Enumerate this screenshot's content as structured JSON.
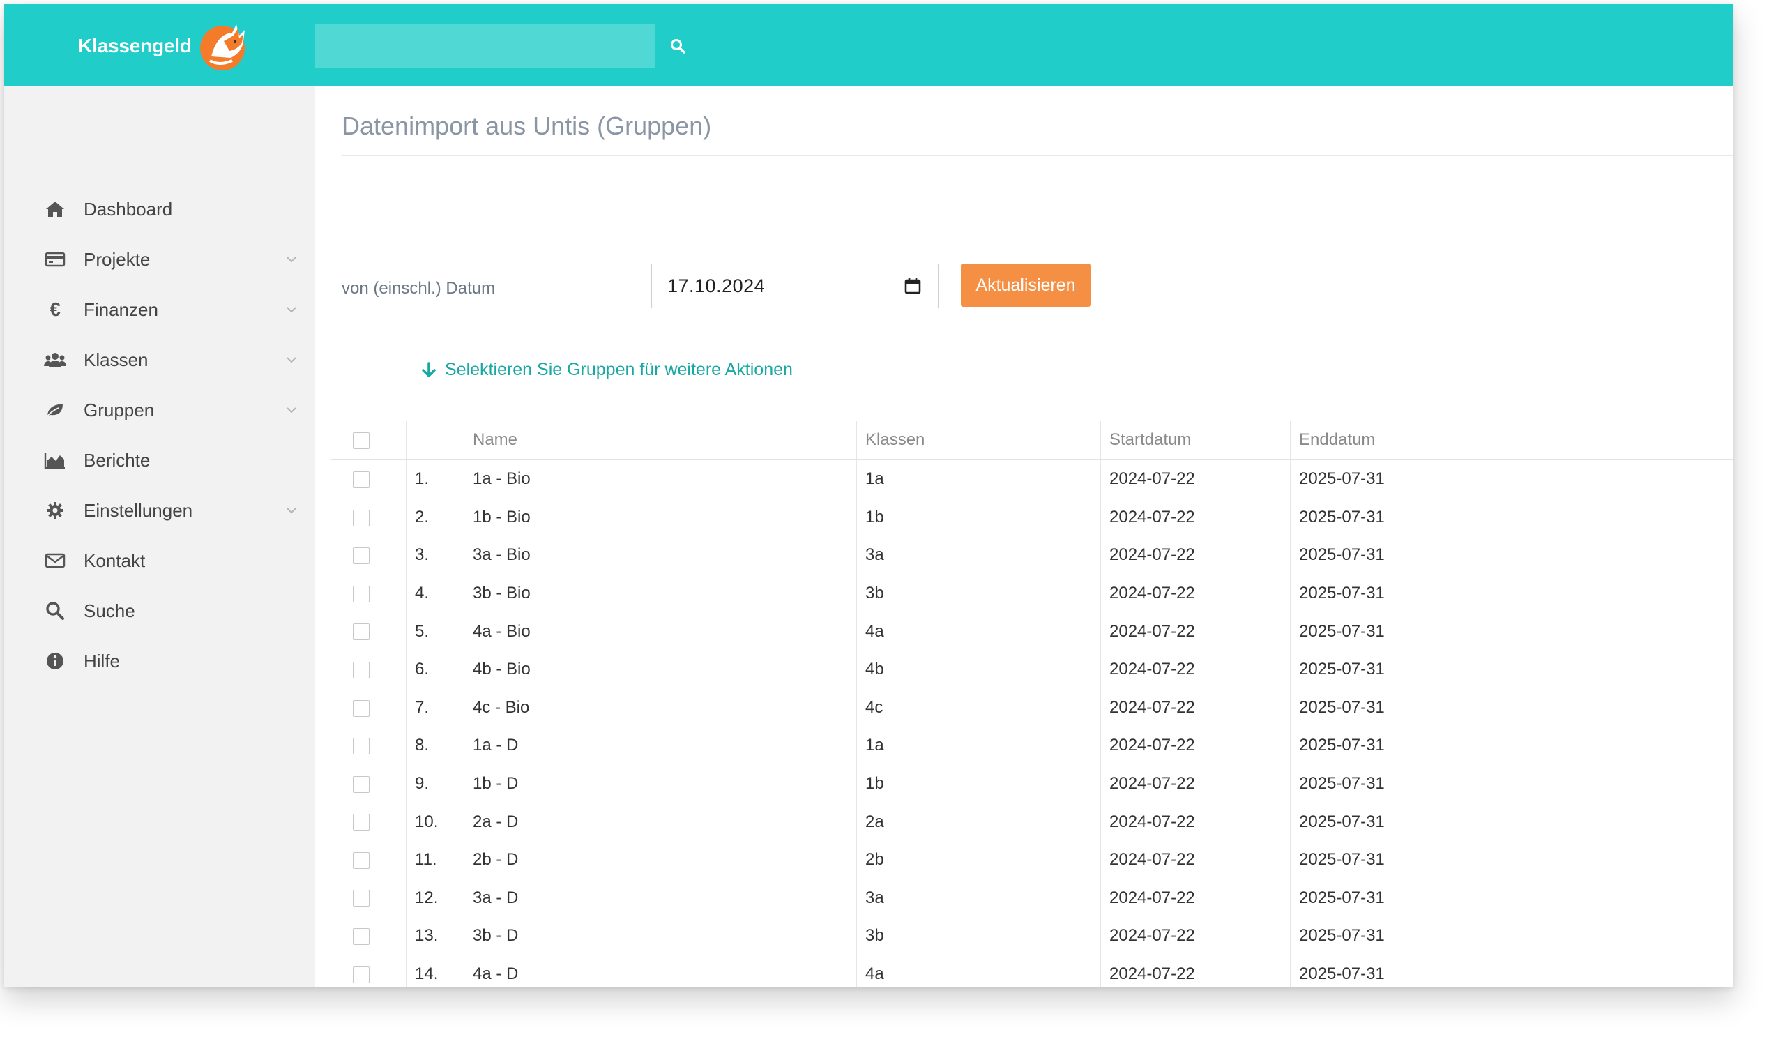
{
  "app": {
    "brand": "Klassengeld",
    "search": {
      "placeholder": "",
      "value": ""
    }
  },
  "sidebar": {
    "items": [
      {
        "label": "Dashboard",
        "icon": "home-icon",
        "expandable": false
      },
      {
        "label": "Projekte",
        "icon": "credit-card-icon",
        "expandable": true
      },
      {
        "label": "Finanzen",
        "icon": "euro-icon",
        "expandable": true
      },
      {
        "label": "Klassen",
        "icon": "users-icon",
        "expandable": true
      },
      {
        "label": "Gruppen",
        "icon": "leaf-icon",
        "expandable": true
      },
      {
        "label": "Berichte",
        "icon": "area-chart-icon",
        "expandable": false
      },
      {
        "label": "Einstellungen",
        "icon": "gear-icon",
        "expandable": true
      },
      {
        "label": "Kontakt",
        "icon": "envelope-icon",
        "expandable": false
      },
      {
        "label": "Suche",
        "icon": "search-icon",
        "expandable": false
      },
      {
        "label": "Hilfe",
        "icon": "info-circle-icon",
        "expandable": false
      }
    ]
  },
  "main": {
    "title": "Datenimport aus Untis (Gruppen)",
    "filter": {
      "label": "von (einschl.) Datum",
      "date_value": "17.10.2024",
      "button_label": "Aktualisieren"
    },
    "hint": "Selektieren Sie Gruppen für weitere Aktionen",
    "table": {
      "headers": {
        "name": "Name",
        "klassen": "Klassen",
        "start": "Startdatum",
        "end": "Enddatum"
      },
      "rows": [
        {
          "num": "1.",
          "name": "1a - Bio",
          "klassen": "1a",
          "start": "2024-07-22",
          "end": "2025-07-31"
        },
        {
          "num": "2.",
          "name": "1b - Bio",
          "klassen": "1b",
          "start": "2024-07-22",
          "end": "2025-07-31"
        },
        {
          "num": "3.",
          "name": "3a - Bio",
          "klassen": "3a",
          "start": "2024-07-22",
          "end": "2025-07-31"
        },
        {
          "num": "4.",
          "name": "3b - Bio",
          "klassen": "3b",
          "start": "2024-07-22",
          "end": "2025-07-31"
        },
        {
          "num": "5.",
          "name": "4a - Bio",
          "klassen": "4a",
          "start": "2024-07-22",
          "end": "2025-07-31"
        },
        {
          "num": "6.",
          "name": "4b - Bio",
          "klassen": "4b",
          "start": "2024-07-22",
          "end": "2025-07-31"
        },
        {
          "num": "7.",
          "name": "4c - Bio",
          "klassen": "4c",
          "start": "2024-07-22",
          "end": "2025-07-31"
        },
        {
          "num": "8.",
          "name": "1a - D",
          "klassen": "1a",
          "start": "2024-07-22",
          "end": "2025-07-31"
        },
        {
          "num": "9.",
          "name": "1b - D",
          "klassen": "1b",
          "start": "2024-07-22",
          "end": "2025-07-31"
        },
        {
          "num": "10.",
          "name": "2a - D",
          "klassen": "2a",
          "start": "2024-07-22",
          "end": "2025-07-31"
        },
        {
          "num": "11.",
          "name": "2b - D",
          "klassen": "2b",
          "start": "2024-07-22",
          "end": "2025-07-31"
        },
        {
          "num": "12.",
          "name": "3a - D",
          "klassen": "3a",
          "start": "2024-07-22",
          "end": "2025-07-31"
        },
        {
          "num": "13.",
          "name": "3b - D",
          "klassen": "3b",
          "start": "2024-07-22",
          "end": "2025-07-31"
        },
        {
          "num": "14.",
          "name": "4a - D",
          "klassen": "4a",
          "start": "2024-07-22",
          "end": "2025-07-31"
        }
      ]
    }
  },
  "colors": {
    "topbar": "#20cdc8",
    "search_bg": "#4fd8d4",
    "sidebar_bg": "#f2f2f2",
    "accent_button": "#f58f44",
    "hint_text": "#1aa8a3",
    "title_text": "#8a96a3"
  }
}
